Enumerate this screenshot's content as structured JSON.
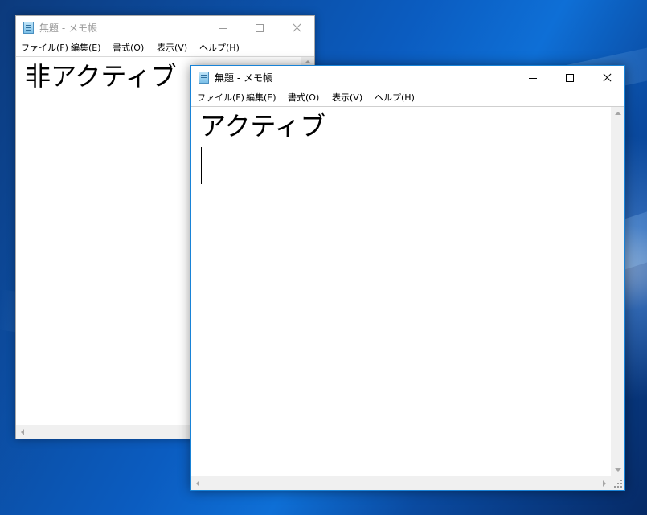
{
  "colors": {
    "desktop_blue": "#0b5cc0",
    "active_border": "#1883d7",
    "inactive_border": "#aaaaaa",
    "inactive_text": "#999999"
  },
  "inactive_window": {
    "title": "無題 - メモ帳",
    "icon": "notepad-icon",
    "menu": [
      "ファイル(F)",
      "編集(E)",
      "書式(O)",
      "表示(V)",
      "ヘルプ(H)"
    ],
    "text": "非アクティブ"
  },
  "active_window": {
    "title": "無題 - メモ帳",
    "icon": "notepad-icon",
    "menu": [
      "ファイル(F)",
      "編集(E)",
      "書式(O)",
      "表示(V)",
      "ヘルプ(H)"
    ],
    "text": "アクティブ"
  }
}
